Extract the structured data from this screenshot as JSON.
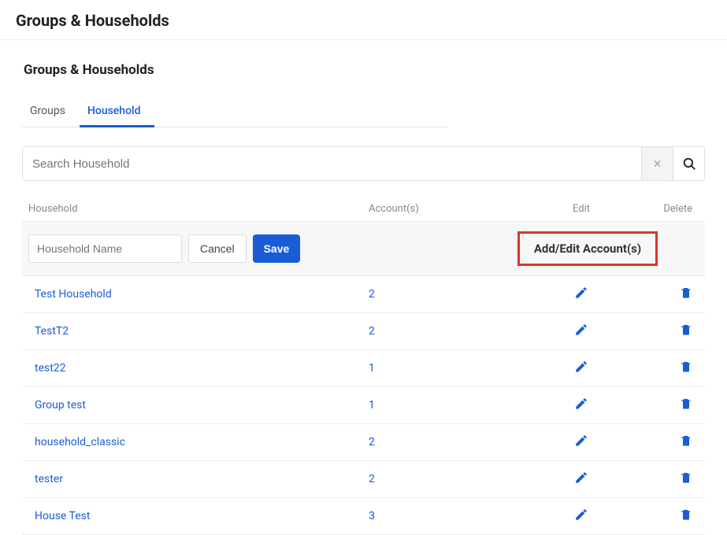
{
  "page": {
    "title": "Groups & Households",
    "section_title": "Groups & Households"
  },
  "tabs": {
    "groups": "Groups",
    "household": "Household"
  },
  "search": {
    "placeholder": "Search Household"
  },
  "headers": {
    "household": "Household",
    "accounts": "Account(s)",
    "edit": "Edit",
    "delete": "Delete"
  },
  "form": {
    "placeholder": "Household Name",
    "cancel": "Cancel",
    "save": "Save",
    "add_edit": "Add/Edit Account(s)"
  },
  "rows": [
    {
      "name": "Test Household",
      "accounts": "2"
    },
    {
      "name": "TestT2",
      "accounts": "2"
    },
    {
      "name": "test22",
      "accounts": "1"
    },
    {
      "name": "Group test",
      "accounts": "1"
    },
    {
      "name": "household_classic",
      "accounts": "2"
    },
    {
      "name": "tester",
      "accounts": "2"
    },
    {
      "name": "House Test",
      "accounts": "3"
    }
  ],
  "colors": {
    "primary": "#1a5cd6",
    "highlight_border": "#d9362a"
  }
}
